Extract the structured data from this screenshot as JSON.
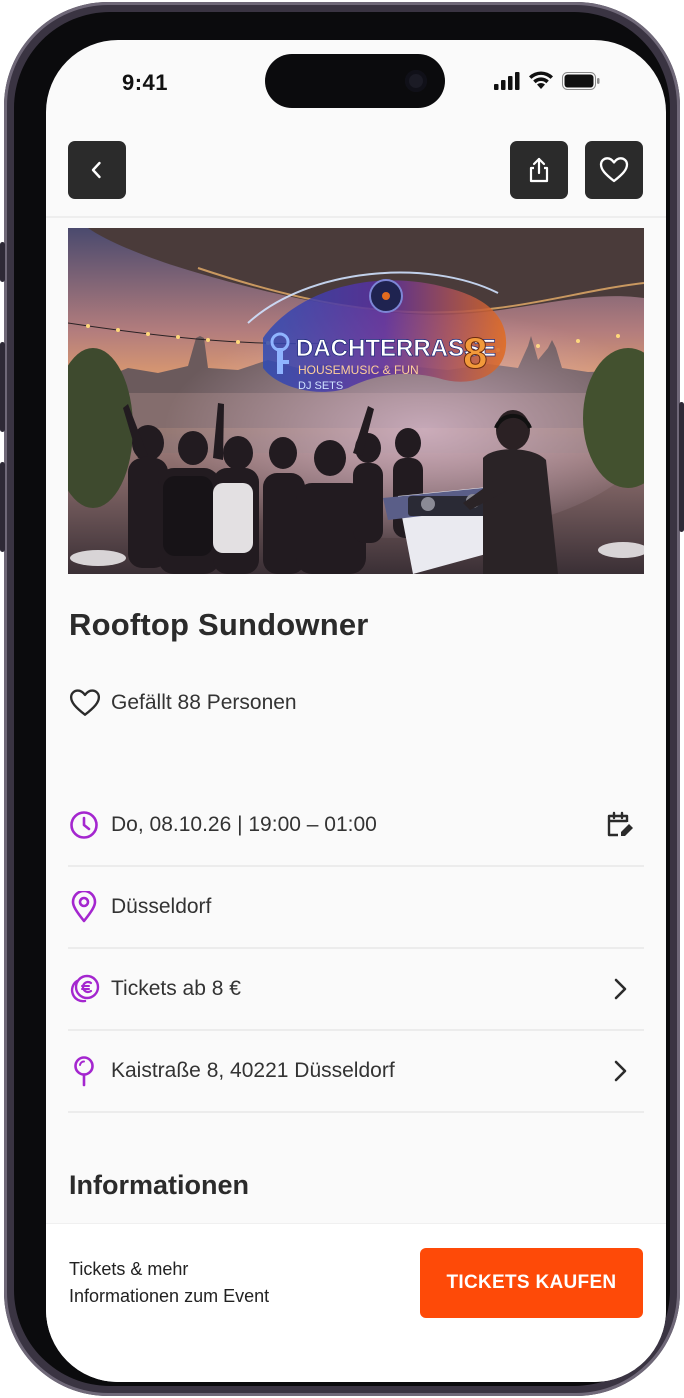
{
  "status_bar": {
    "time": "9:41"
  },
  "event": {
    "title": "Rooftop Sundowner",
    "likes": "Gefällt 88 Personen",
    "hero_image": {
      "logo_title": "DACHTERRASSE",
      "logo_subtitle": "HOUSEMUSIC & FUN",
      "logo_tag": "DJ SETS",
      "logo_number": "8"
    },
    "details": [
      {
        "icon": "clock-icon",
        "text": "Do, 08.10.26 | 19:00 – 01:00",
        "trailing": "calendar-edit-icon"
      },
      {
        "icon": "location-pin-icon",
        "text": "Düsseldorf",
        "trailing": ""
      },
      {
        "icon": "euro-coins-icon",
        "text": "Tickets ab 8 €",
        "trailing": "chevron-right-icon"
      },
      {
        "icon": "map-pin-icon",
        "text": "Kaistraße 8, 40221 Düsseldorf",
        "trailing": "chevron-right-icon"
      }
    ],
    "section_title": "Informationen"
  },
  "bottom_bar": {
    "line1": "Tickets & mehr",
    "line2": "Informationen zum Event",
    "cta_label": "TICKETS KAUFEN"
  },
  "colors": {
    "accent": "#a426cf",
    "cta": "#fe4a08",
    "nav_button": "#2b2b2b"
  }
}
